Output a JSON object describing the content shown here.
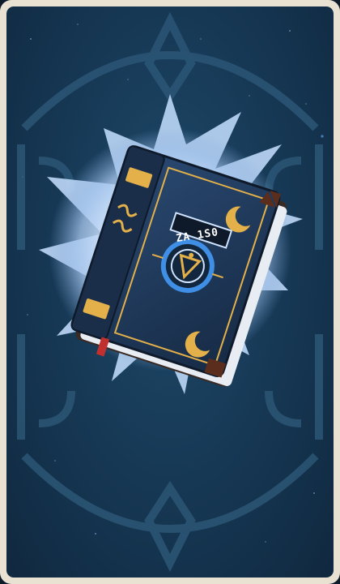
{
  "card": {
    "item_icon": "magic-tome-icon",
    "cover_glyph": "ZA 1S0",
    "emblem_icon": "triangle-eye-emblem-icon"
  },
  "colors": {
    "frame": "#e9e2d2",
    "background": "#173a57",
    "glow": "#cfe3ff",
    "book_cover": "#1f3553",
    "gold": "#e3b04a",
    "emblem": "#3f8fe6"
  }
}
